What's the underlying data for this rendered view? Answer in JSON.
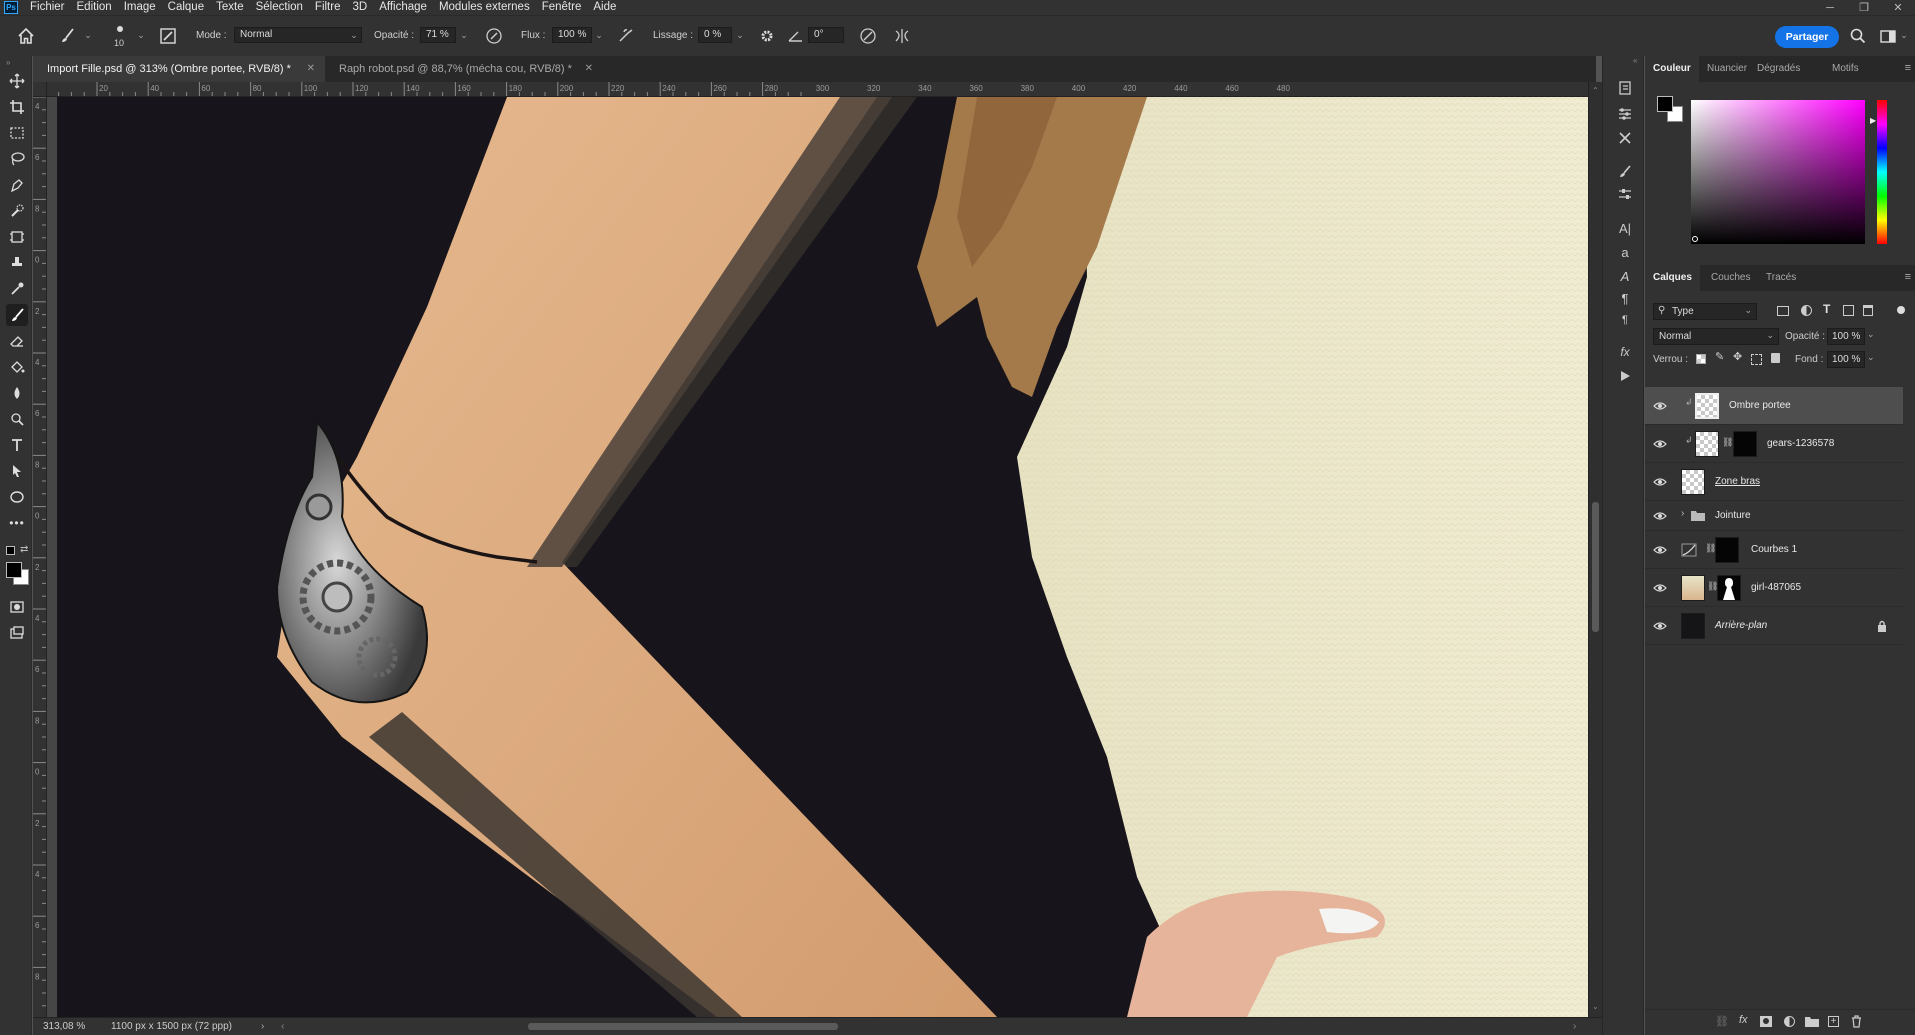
{
  "app": {
    "logo": "Ps",
    "menu": [
      "Fichier",
      "Edition",
      "Image",
      "Calque",
      "Texte",
      "Sélection",
      "Filtre",
      "3D",
      "Affichage",
      "Modules externes",
      "Fenêtre",
      "Aide"
    ]
  },
  "options": {
    "brush_size": "10",
    "mode_label": "Mode :",
    "mode_value": "Normal",
    "opacity_label": "Opacité :",
    "opacity_value": "71 %",
    "flow_label": "Flux :",
    "flow_value": "100 %",
    "smoothing_label": "Lissage :",
    "smoothing_value": "0 %",
    "angle_value": "0°",
    "share_label": "Partager"
  },
  "tabs": [
    {
      "label": "Import Fille.psd @ 313% (Ombre portee, RVB/8) *",
      "active": true
    },
    {
      "label": "Raph robot.psd @ 88,7% (mécha cou, RVB/8) *",
      "active": false
    }
  ],
  "rulers": {
    "h_ticks": [
      "20",
      "40",
      "60",
      "80",
      "100",
      "120",
      "140",
      "160",
      "180",
      "200",
      "220",
      "240",
      "260",
      "280",
      "300",
      "320",
      "340",
      "360",
      "380",
      "400",
      "420",
      "440",
      "460",
      "480"
    ],
    "v_ticks": [
      "4",
      "6",
      "8",
      "0",
      "2",
      "4",
      "6",
      "8",
      "0",
      "2",
      "4",
      "6",
      "8",
      "0",
      "2",
      "4",
      "6",
      "8"
    ]
  },
  "status": {
    "zoom": "313,08 %",
    "doc_size": "1100 px x 1500 px (72 ppp)"
  },
  "color_panel": {
    "tabs": [
      "Couleur",
      "Nuancier",
      "Dégradés",
      "Motifs"
    ]
  },
  "layers_panel": {
    "tabs": [
      "Calques",
      "Couches",
      "Tracés"
    ],
    "filter_value": "Type",
    "blend_mode": "Normal",
    "opacity_label": "Opacité :",
    "opacity_value": "100 %",
    "lock_label": "Verrou :",
    "fill_label": "Fond :",
    "fill_value": "100 %",
    "layers": [
      {
        "name": "Ombre portee",
        "selected": true
      },
      {
        "name": "gears-1236578",
        "selected": false
      },
      {
        "name": "Zone bras",
        "selected": false
      },
      {
        "name": "Jointure",
        "selected": false
      },
      {
        "name": "Courbes 1",
        "selected": false
      },
      {
        "name": "girl-487065",
        "selected": false
      },
      {
        "name": "Arrière-plan",
        "selected": false
      }
    ]
  },
  "colors": {
    "accent": "#1473e6",
    "background": "#535353",
    "panel": "#323232"
  }
}
